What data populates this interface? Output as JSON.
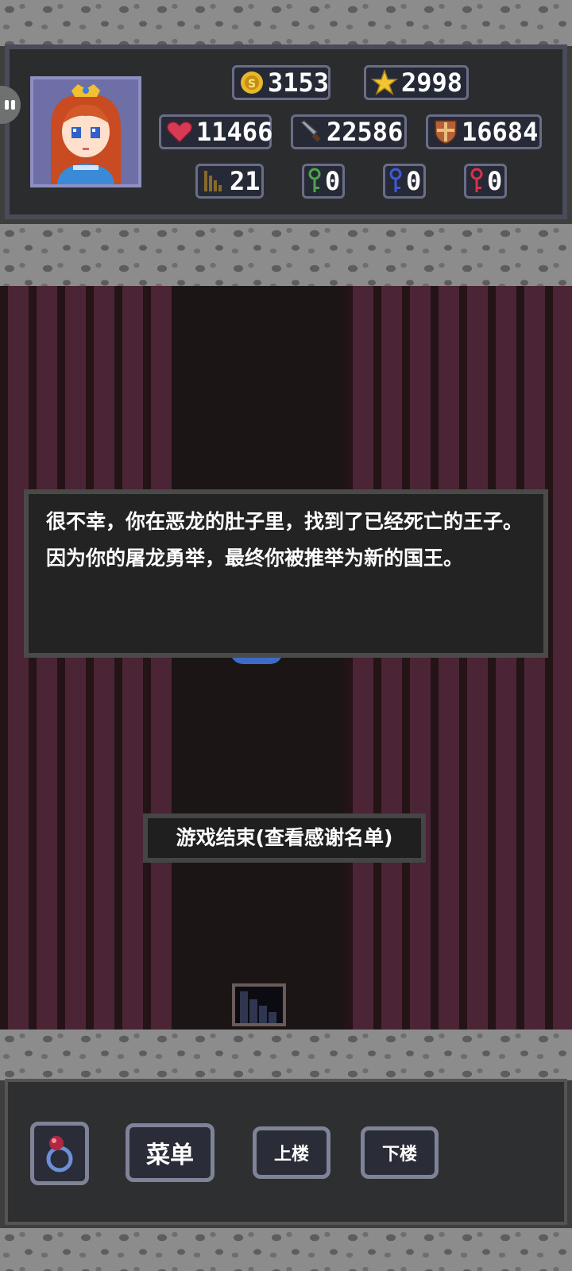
{
  "hud": {
    "gold": "3153",
    "experience": "2998",
    "hp": "11466",
    "attack": "22586",
    "defense": "16684",
    "floor": "21",
    "green_keys": "0",
    "blue_keys": "0",
    "red_keys": "0"
  },
  "dialog": {
    "text": "很不幸，你在恶龙的肚子里，找到了已经死亡的王子。因为你的屠龙勇举，最终你被推举为新的国王。"
  },
  "end_button": {
    "label": "游戏结束(查看感谢名单)"
  },
  "toolbar": {
    "menu_label": "菜单",
    "up_label": "上楼",
    "down_label": "下楼"
  },
  "colors": {
    "panel": "#2b2c2e",
    "wall_brick": "#4b2536",
    "wall_bg": "#241418",
    "stone": "#8c8c8c",
    "key_green": "#4ca44c",
    "key_blue": "#3f5ad9",
    "key_red": "#d6334b"
  },
  "icons": [
    "coin-icon",
    "star-icon",
    "heart-icon",
    "sword-icon",
    "shield-icon",
    "stairs-icon",
    "green-key-icon",
    "blue-key-icon",
    "red-key-icon",
    "ring-icon"
  ]
}
